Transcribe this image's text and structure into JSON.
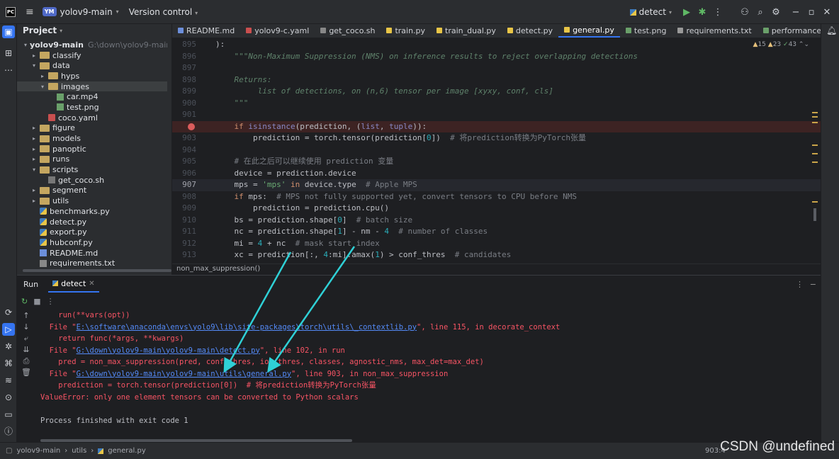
{
  "titlebar": {
    "logo": "PC",
    "project_badge": "YM",
    "project_name": "yolov9-main",
    "vcs_label": "Version control",
    "run_config": "detect"
  },
  "project_panel": {
    "title": "Project",
    "root": {
      "name": "yolov9-main",
      "path": "G:\\down\\yolov9-main\\yolov9-main"
    },
    "items": [
      {
        "label": "classify",
        "kind": "folder",
        "depth": 1,
        "expanded": false
      },
      {
        "label": "data",
        "kind": "folder",
        "depth": 1,
        "expanded": true
      },
      {
        "label": "hyps",
        "kind": "folder",
        "depth": 2,
        "expanded": false
      },
      {
        "label": "images",
        "kind": "folder",
        "depth": 2,
        "expanded": true
      },
      {
        "label": "car.mp4",
        "kind": "file-media",
        "depth": 3
      },
      {
        "label": "test.png",
        "kind": "file-image",
        "depth": 3
      },
      {
        "label": "coco.yaml",
        "kind": "file-yaml",
        "depth": 2
      },
      {
        "label": "figure",
        "kind": "folder",
        "depth": 1,
        "expanded": false
      },
      {
        "label": "models",
        "kind": "folder",
        "depth": 1,
        "expanded": false
      },
      {
        "label": "panoptic",
        "kind": "folder",
        "depth": 1,
        "expanded": false
      },
      {
        "label": "runs",
        "kind": "folder",
        "depth": 1,
        "expanded": false
      },
      {
        "label": "scripts",
        "kind": "folder",
        "depth": 1,
        "expanded": true
      },
      {
        "label": "get_coco.sh",
        "kind": "file-sh",
        "depth": 2
      },
      {
        "label": "segment",
        "kind": "folder",
        "depth": 1,
        "expanded": false
      },
      {
        "label": "utils",
        "kind": "folder",
        "depth": 1,
        "expanded": false
      },
      {
        "label": "benchmarks.py",
        "kind": "file-py",
        "depth": 1
      },
      {
        "label": "detect.py",
        "kind": "file-py",
        "depth": 1
      },
      {
        "label": "export.py",
        "kind": "file-py",
        "depth": 1
      },
      {
        "label": "hubconf.py",
        "kind": "file-py",
        "depth": 1
      },
      {
        "label": "README.md",
        "kind": "file-md",
        "depth": 1
      },
      {
        "label": "requirements.txt",
        "kind": "file-txt",
        "depth": 1
      }
    ]
  },
  "editor_tabs": [
    {
      "label": "README.md",
      "kind": "md",
      "active": false
    },
    {
      "label": "yolov9-c.yaml",
      "kind": "yaml",
      "active": false
    },
    {
      "label": "get_coco.sh",
      "kind": "sh",
      "active": false
    },
    {
      "label": "train.py",
      "kind": "py",
      "active": false
    },
    {
      "label": "train_dual.py",
      "kind": "py",
      "active": false
    },
    {
      "label": "detect.py",
      "kind": "py",
      "active": false
    },
    {
      "label": "general.py",
      "kind": "py",
      "active": true
    },
    {
      "label": "test.png",
      "kind": "img",
      "active": false
    },
    {
      "label": "requirements.txt",
      "kind": "txt",
      "active": false
    },
    {
      "label": "performance.png",
      "kind": "img",
      "active": false
    }
  ],
  "inspections": {
    "warnings": "15",
    "weak_warnings": "23",
    "typos": "43"
  },
  "editor_lines": [
    {
      "n": "895",
      "code": "):"
    },
    {
      "n": "896",
      "code": "    \"\"\"Non-Maximum Suppression (NMS) on inference results to reject overlapping detections"
    },
    {
      "n": "897",
      "code": ""
    },
    {
      "n": "898",
      "code": "    Returns:"
    },
    {
      "n": "899",
      "code": "         list of detections, on (n,6) tensor per image [xyxy, conf, cls]"
    },
    {
      "n": "900",
      "code": "    \"\"\""
    },
    {
      "n": "901",
      "code": ""
    },
    {
      "n": "",
      "code": "    if isinstance(prediction, (list, tuple)):"
    },
    {
      "n": "903",
      "code": "        prediction = torch.tensor(prediction[0])  # 将prediction转换为PyTorch张量"
    },
    {
      "n": "904",
      "code": ""
    },
    {
      "n": "905",
      "code": "    # 在此之后可以继续使用 prediction 变量"
    },
    {
      "n": "906",
      "code": "    device = prediction.device"
    },
    {
      "n": "907",
      "code": "    mps = 'mps' in device.type  # Apple MPS"
    },
    {
      "n": "908",
      "code": "    if mps:  # MPS not fully supported yet, convert tensors to CPU before NMS"
    },
    {
      "n": "909",
      "code": "        prediction = prediction.cpu()"
    },
    {
      "n": "910",
      "code": "    bs = prediction.shape[0]  # batch size"
    },
    {
      "n": "911",
      "code": "    nc = prediction.shape[1] - nm - 4  # number of classes"
    },
    {
      "n": "912",
      "code": "    mi = 4 + nc  # mask start index"
    },
    {
      "n": "913",
      "code": "    xc = prediction[:, 4:mi].amax(1) > conf_thres  # candidates"
    }
  ],
  "editor_breadcrumb": "non_max_suppression()",
  "run_panel": {
    "title": "Run",
    "tab": "detect",
    "console": [
      {
        "prefix": "    run(**vars(opt))",
        "link": "",
        "suffix": ""
      },
      {
        "prefix": "  File \"",
        "link": "E:\\software\\anaconda\\envs\\yolo9\\lib\\site-packages\\torch\\utils\\_contextlib.py",
        "suffix": "\", line 115, in decorate_context"
      },
      {
        "prefix": "    return func(*args, **kwargs)",
        "link": "",
        "suffix": ""
      },
      {
        "prefix": "  File \"",
        "link": "G:\\down\\yolov9-main\\yolov9-main\\detect.py",
        "suffix": "\", line 102, in run"
      },
      {
        "prefix": "    pred = non_max_suppression(pred, conf_thres, iou_thres, classes, agnostic_nms, max_det=max_det)",
        "link": "",
        "suffix": ""
      },
      {
        "prefix": "  File \"",
        "link": "G:\\down\\yolov9-main\\yolov9-main\\utils\\general.py",
        "suffix": "\", line 903, in non_max_suppression"
      },
      {
        "prefix": "    prediction = torch.tensor(prediction[0])  # 将prediction转换为PyTorch张量",
        "link": "",
        "suffix": ""
      },
      {
        "prefix": "ValueError: only one element tensors can be converted to Python scalars",
        "link": "",
        "suffix": ""
      },
      {
        "prefix": "",
        "link": "",
        "suffix": ""
      },
      {
        "prefix": "Process finished with exit code 1",
        "link": "",
        "suffix": "",
        "plain": true
      }
    ]
  },
  "statusbar": {
    "crumbs": [
      "yolov9-main",
      "utils",
      "general.py"
    ],
    "position": "903:4"
  },
  "watermark": "CSDN @undefined",
  "colors": {
    "accent": "#3574f0",
    "error": "#f75464",
    "annotation_arrow": "#2fd0d6"
  }
}
